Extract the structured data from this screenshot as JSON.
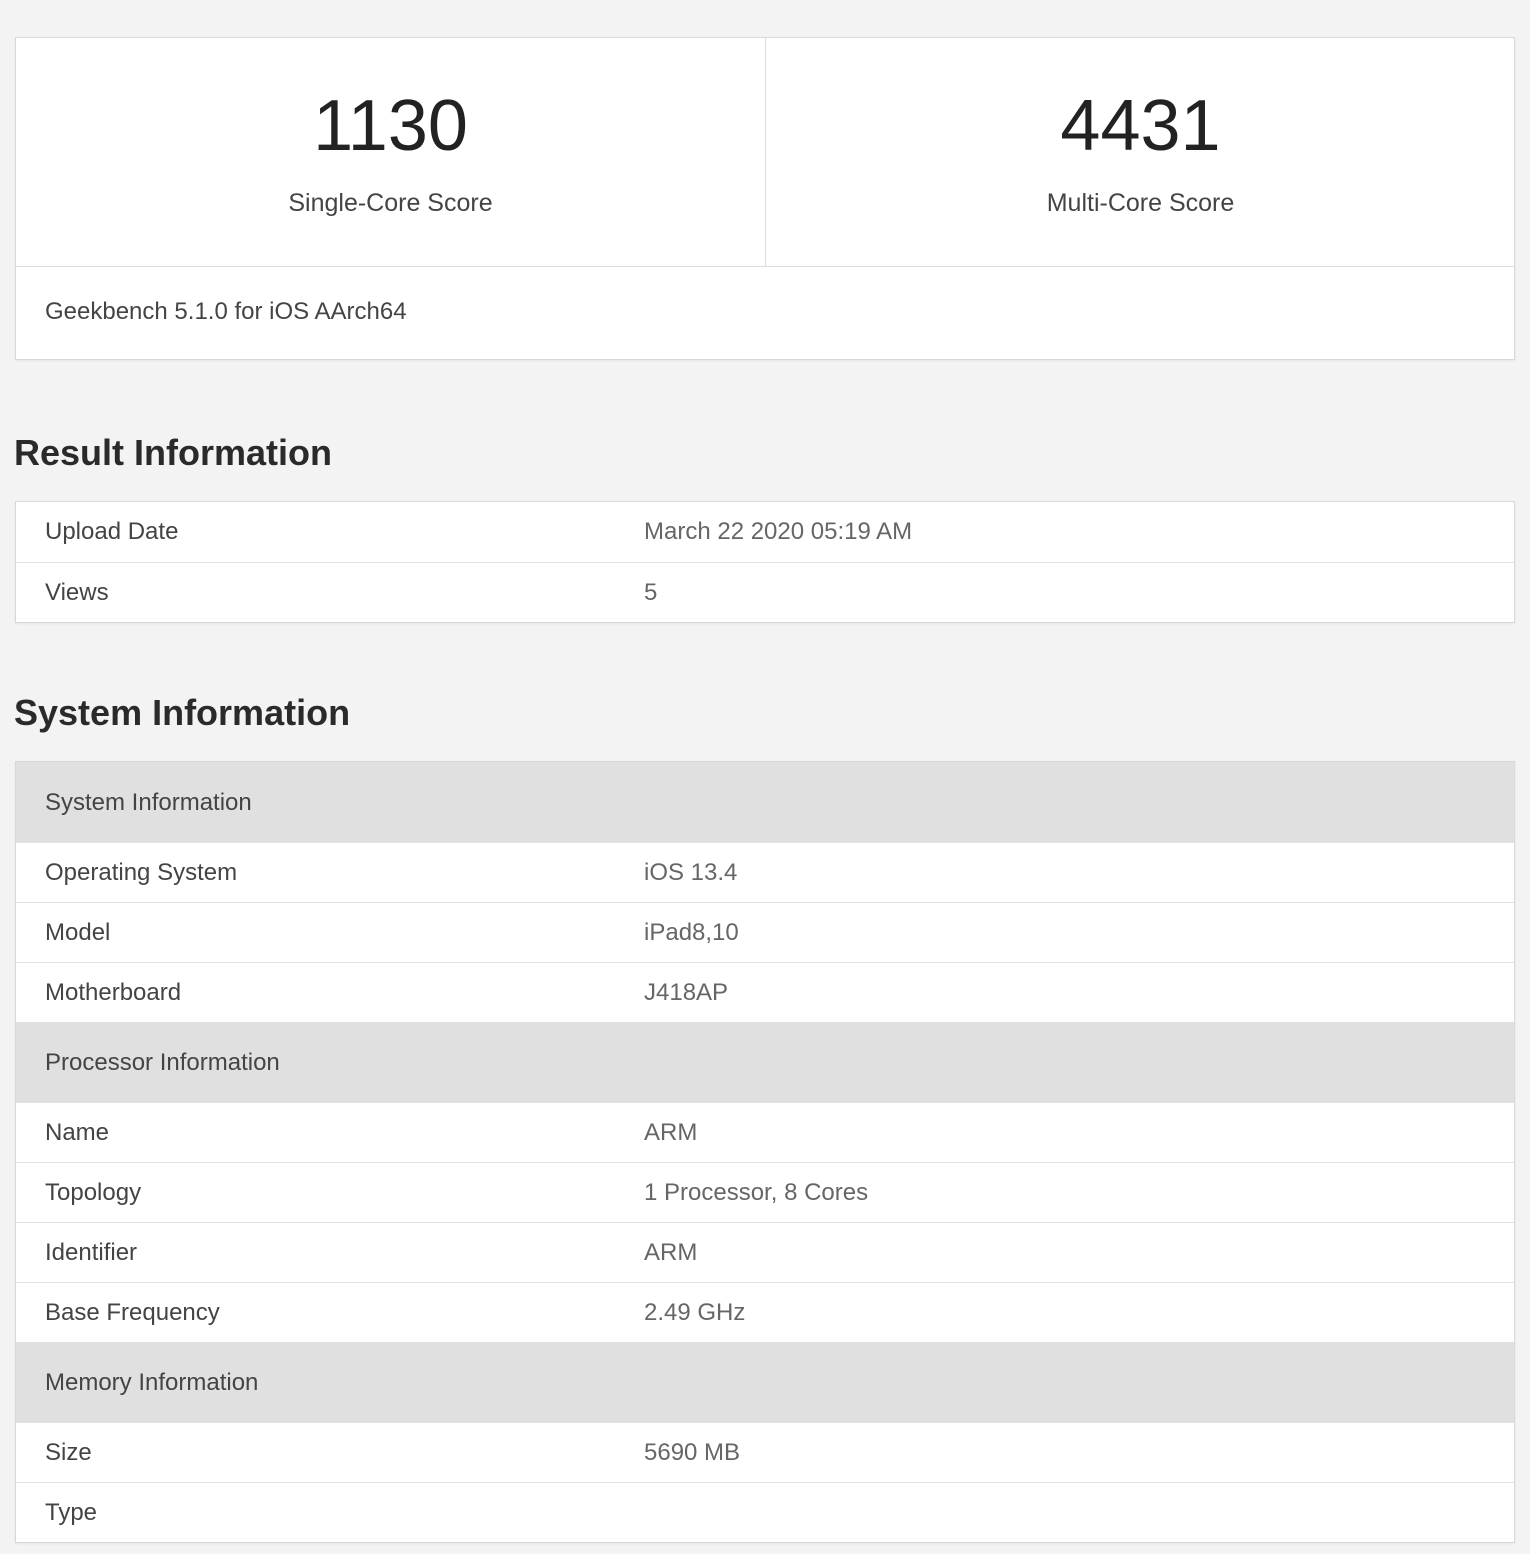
{
  "scores": {
    "single": {
      "value": "1130",
      "label": "Single-Core Score"
    },
    "multi": {
      "value": "4431",
      "label": "Multi-Core Score"
    },
    "version": "Geekbench 5.1.0 for iOS AArch64"
  },
  "result": {
    "title": "Result Information",
    "rows": [
      {
        "key": "Upload Date",
        "value": "March 22 2020 05:19 AM"
      },
      {
        "key": "Views",
        "value": "5"
      }
    ]
  },
  "system": {
    "title": "System Information",
    "groups": [
      {
        "name": "System Information",
        "rows": [
          {
            "key": "Operating System",
            "value": "iOS 13.4"
          },
          {
            "key": "Model",
            "value": "iPad8,10"
          },
          {
            "key": "Motherboard",
            "value": "J418AP"
          }
        ]
      },
      {
        "name": "Processor Information",
        "rows": [
          {
            "key": "Name",
            "value": "ARM"
          },
          {
            "key": "Topology",
            "value": "1 Processor, 8 Cores"
          },
          {
            "key": "Identifier",
            "value": "ARM"
          },
          {
            "key": "Base Frequency",
            "value": "2.49 GHz"
          }
        ]
      },
      {
        "name": "Memory Information",
        "rows": [
          {
            "key": "Size",
            "value": "5690 MB"
          },
          {
            "key": "Type",
            "value": ""
          }
        ]
      }
    ]
  }
}
